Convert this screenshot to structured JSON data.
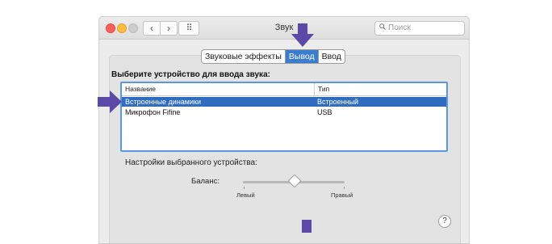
{
  "window": {
    "title": "Звук",
    "search_placeholder": "Поиск",
    "nav": {
      "back_glyph": "‹",
      "forward_glyph": "›",
      "grid_glyph": "⠿"
    }
  },
  "tabs": [
    {
      "label": "Звуковые эффекты",
      "active": false
    },
    {
      "label": "Вывод",
      "active": true
    },
    {
      "label": "Ввод",
      "active": false
    }
  ],
  "output": {
    "heading": "Выберите устройство для ввода звука:",
    "columns": [
      "Название",
      "Тип"
    ],
    "devices": [
      {
        "name": "Встроенные динамики",
        "type": "Встроенный",
        "selected": true
      },
      {
        "name": "Микрофон Fifine",
        "type": "USB",
        "selected": false
      }
    ],
    "device_settings_label": "Настройки выбранного устройства:",
    "balance": {
      "label": "Баланс:",
      "min_label": "Левый",
      "max_label": "Правый",
      "value": 0.5
    }
  },
  "help_label": "?",
  "colors": {
    "selection": "#2f6cc0",
    "active_tab": "#3a7ccd",
    "annotation_arrow": "#5a49a6"
  }
}
